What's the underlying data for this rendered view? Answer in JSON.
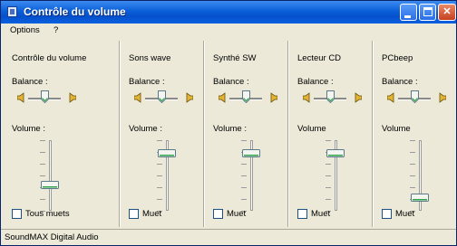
{
  "window": {
    "title": "Contrôle du volume"
  },
  "menu": {
    "options": "Options",
    "help": "?"
  },
  "labels": {
    "balance": "Balance :",
    "volume": "Volume :"
  },
  "panels": [
    {
      "title": "Contrôle du volume",
      "balance_label": "Balance :",
      "volume_label": "Volume :",
      "mute_label": "Tous muets",
      "volume_level": 0.35,
      "balance": 0.5
    },
    {
      "title": "Sons wave",
      "balance_label": "Balance :",
      "volume_label": "Volume :",
      "mute_label": "Muet",
      "volume_level": 0.85,
      "balance": 0.5
    },
    {
      "title": "Synthé SW",
      "balance_label": "Balance :",
      "volume_label": "Volume :",
      "mute_label": "Muet",
      "volume_level": 0.85,
      "balance": 0.5
    },
    {
      "title": "Lecteur CD",
      "balance_label": "Balance :",
      "volume_label": "Volume",
      "mute_label": "Muet",
      "volume_level": 0.85,
      "balance": 0.5
    },
    {
      "title": "PCbeep",
      "balance_label": "Balance :",
      "volume_label": "Volume",
      "mute_label": "Muet",
      "volume_level": 0.15,
      "balance": 0.5
    }
  ],
  "status": {
    "device": "SoundMAX Digital Audio"
  },
  "colors": {
    "title_bar": "#0a5fd8",
    "window_bg": "#ece9d8",
    "thumb_accent": "#2fa34a"
  }
}
